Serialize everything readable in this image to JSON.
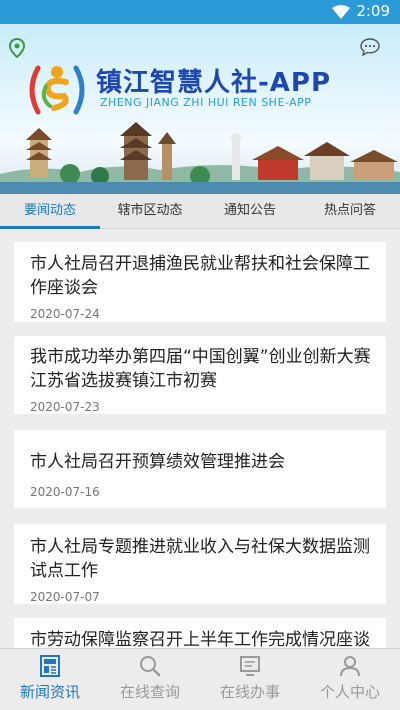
{
  "status_bar": {
    "time": "2:09"
  },
  "banner": {
    "title": "镇江智慧人社-APP",
    "subtitle": "ZHENG JIANG ZHI HUI REN SHE-APP"
  },
  "tabs": [
    {
      "label": "要闻动态",
      "active": true
    },
    {
      "label": "辖市区动态",
      "active": false
    },
    {
      "label": "通知公告",
      "active": false
    },
    {
      "label": "热点问答",
      "active": false
    }
  ],
  "news": [
    {
      "title": "市人社局召开退捕渔民就业帮扶和社会保障工作座谈会",
      "date": "2020-07-24"
    },
    {
      "title": "我市成功举办第四届“中国创翼”创业创新大赛江苏省选拔赛镇江市初赛",
      "date": "2020-07-23"
    },
    {
      "title": "市人社局召开预算绩效管理推进会",
      "date": "2020-07-16"
    },
    {
      "title": "市人社局专题推进就业收入与社保大数据监测试点工作",
      "date": "2020-07-07"
    },
    {
      "title": "市劳动保障监察召开上半年工作完成情况座谈",
      "date": ""
    }
  ],
  "bottom_nav": [
    {
      "label": "新闻资讯",
      "icon": "news-icon",
      "active": true
    },
    {
      "label": "在线查询",
      "icon": "search-icon",
      "active": false
    },
    {
      "label": "在线办事",
      "icon": "monitor-icon",
      "active": false
    },
    {
      "label": "个人中心",
      "icon": "person-icon",
      "active": false
    }
  ],
  "colors": {
    "accent": "#1f77c4",
    "status_bar": "#2a9bd6",
    "title": "#1e47b0"
  }
}
